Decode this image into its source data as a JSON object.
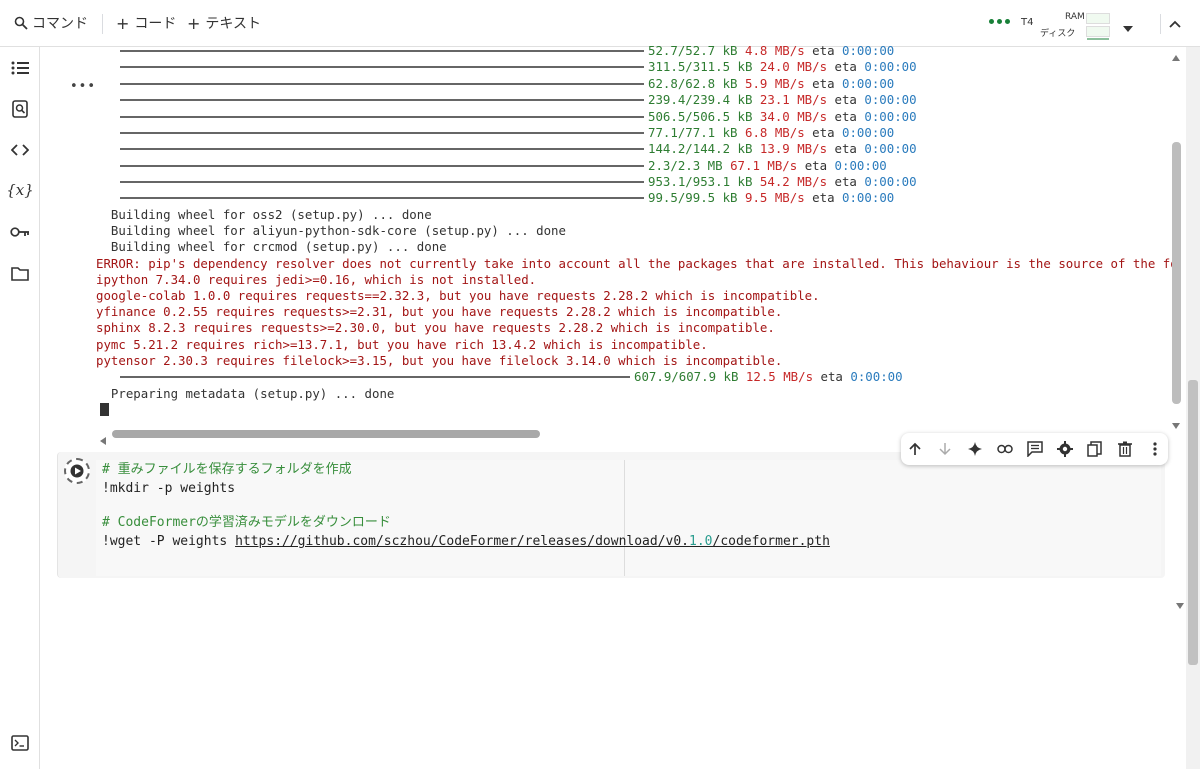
{
  "toolbar": {
    "command_label": "コマンド",
    "code_label": "コード",
    "text_label": "テキスト",
    "runtime_label": "T4",
    "ram_label": "RAM",
    "disk_label": "ディスク",
    "status_color": "#188038"
  },
  "output": {
    "downloads": [
      {
        "size": "52.7/52.7 kB",
        "speed": "4.8 MB/s",
        "eta": "0:00:00"
      },
      {
        "size": "311.5/311.5 kB",
        "speed": "24.0 MB/s",
        "eta": "0:00:00"
      },
      {
        "size": "62.8/62.8 kB",
        "speed": "5.9 MB/s",
        "eta": "0:00:00"
      },
      {
        "size": "239.4/239.4 kB",
        "speed": "23.1 MB/s",
        "eta": "0:00:00"
      },
      {
        "size": "506.5/506.5 kB",
        "speed": "34.0 MB/s",
        "eta": "0:00:00"
      },
      {
        "size": "77.1/77.1 kB",
        "speed": "6.8 MB/s",
        "eta": "0:00:00"
      },
      {
        "size": "144.2/144.2 kB",
        "speed": "13.9 MB/s",
        "eta": "0:00:00"
      },
      {
        "size": "2.3/2.3 MB",
        "speed": "67.1 MB/s",
        "eta": "0:00:00"
      },
      {
        "size": "953.1/953.1 kB",
        "speed": "54.2 MB/s",
        "eta": "0:00:00"
      },
      {
        "size": "99.5/99.5 kB",
        "speed": "9.5 MB/s",
        "eta": "0:00:00"
      }
    ],
    "build_lines": [
      "  Building wheel for oss2 (setup.py) ... done",
      "  Building wheel for aliyun-python-sdk-core (setup.py) ... done",
      "  Building wheel for crcmod (setup.py) ... done"
    ],
    "error_lines": [
      "ERROR: pip's dependency resolver does not currently take into account all the packages that are installed. This behaviour is the source of the following dependency",
      "ipython 7.34.0 requires jedi>=0.16, which is not installed.",
      "google-colab 1.0.0 requires requests==2.32.3, but you have requests 2.28.2 which is incompatible.",
      "yfinance 0.2.55 requires requests>=2.31, but you have requests 2.28.2 which is incompatible.",
      "sphinx 8.2.3 requires requests>=2.30.0, but you have requests 2.28.2 which is incompatible.",
      "pymc 5.21.2 requires rich>=13.7.1, but you have rich 13.4.2 which is incompatible.",
      "pytensor 2.30.3 requires filelock>=3.15, but you have filelock 3.14.0 which is incompatible."
    ],
    "last_download": {
      "size": "607.9/607.9 kB",
      "speed": "12.5 MB/s",
      "eta": "0:00:00"
    },
    "prep_line": "  Preparing metadata (setup.py) ... done"
  },
  "cell": {
    "comment1": "# 重みファイルを保存するフォルダを作成",
    "line2": "!mkdir -p weights",
    "comment2": "# CodeFormerの学習済みモデルをダウンロード",
    "wget_prefix": "!wget -P weights ",
    "url_a": "https://github.com/sczhou/CodeFormer/releases/download/v0.",
    "url_b": "1.0",
    "url_c": "/codeformer.pth"
  }
}
